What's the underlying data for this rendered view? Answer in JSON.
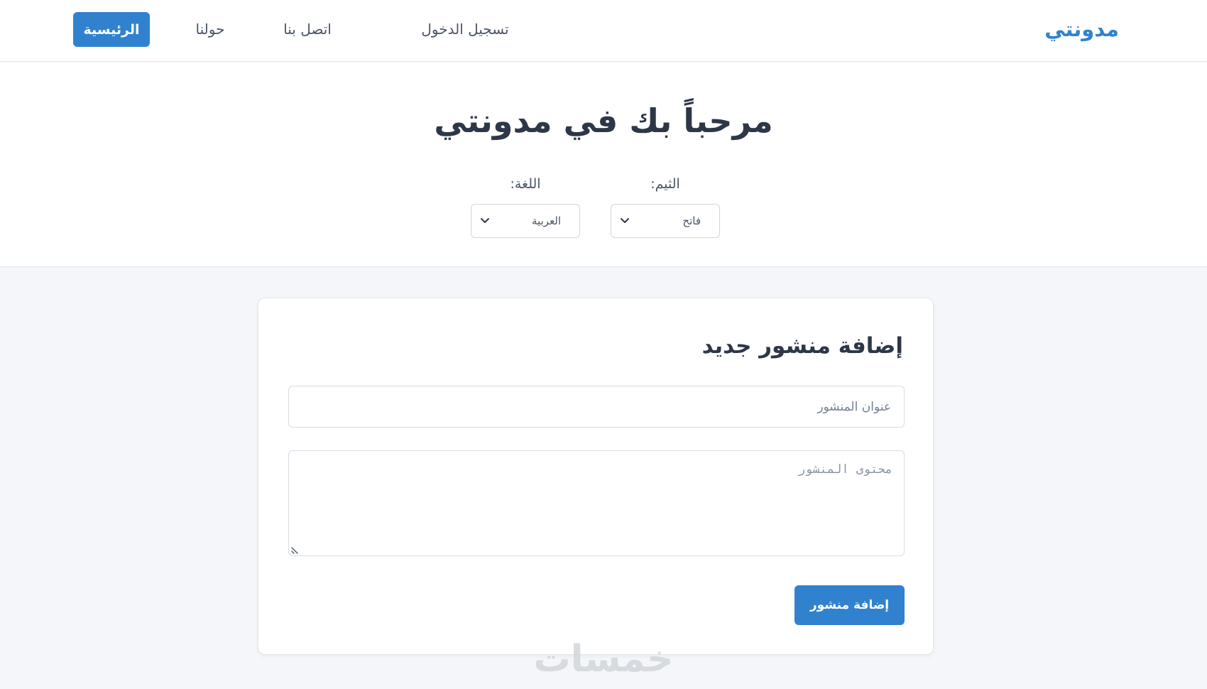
{
  "navbar": {
    "brand": "مدونتي",
    "links": {
      "login": "تسجيل الدخول",
      "contact": "اتصل بنا",
      "about": "حولنا",
      "home": "الرئيسية"
    }
  },
  "hero": {
    "title": "مرحباً بك في مدونتي",
    "theme": {
      "label": "الثيم:",
      "selected": "فاتح",
      "icon": "chevron-down-icon"
    },
    "language": {
      "label": "اللغة:",
      "selected": "العربية",
      "icon": "chevron-down-icon"
    }
  },
  "post_form": {
    "heading": "إضافة منشور جديد",
    "title_placeholder": "عنوان المنشور",
    "content_placeholder": "محتوى المنشور",
    "submit_label": "إضافة منشور"
  },
  "watermark": "خمسات",
  "colors": {
    "accent": "#3182ce",
    "text": "#2d3748",
    "page_background": "#f4f6f9"
  }
}
